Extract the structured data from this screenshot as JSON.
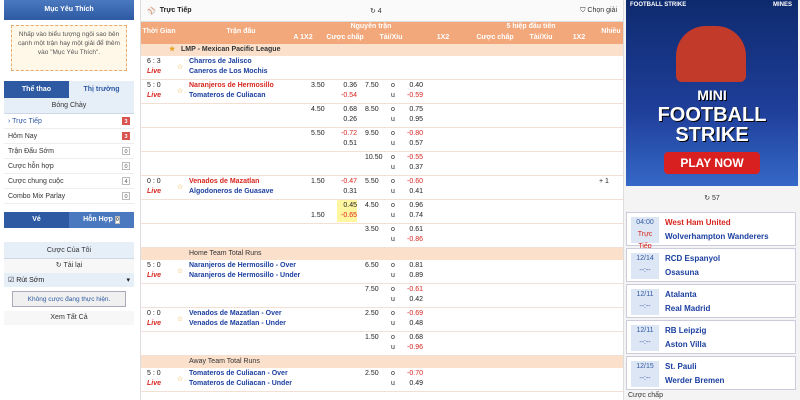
{
  "left": {
    "favorites_title": "Mục Yêu Thích",
    "favorites_hint": "Nhấp vào biểu tượng ngôi sao bên cạnh một trận hay một giải để thêm vào \"Mục Yêu Thích\".",
    "tab_sports": "Thể thao",
    "tab_market": "Thị trường",
    "sport_header": "Bóng Chày",
    "menu": [
      {
        "label": "Trực Tiếp",
        "count": "3"
      },
      {
        "label": "Hôm Nay",
        "count": "3"
      },
      {
        "label": "Trận Đấu Sớm",
        "count": "0"
      },
      {
        "label": "Cược hỗn hợp",
        "count": "0"
      },
      {
        "label": "Cược chung cuộc",
        "count": "4"
      },
      {
        "label": "Combo Mix Parlay",
        "count": "0"
      }
    ],
    "slip_single": "Vé",
    "slip_mix": "Hỗn Hợp",
    "slip_mix_count": "0",
    "mybets_title": "Cược Của Tôi",
    "reload": "Tải lại",
    "cashout": "Rút Sớm",
    "no_bets": "Không cược đang thực hiện.",
    "view_all": "Xem Tất Cả"
  },
  "main": {
    "live_label": "Trực Tiếp",
    "live_count": "4",
    "select_league": "Chọn giải",
    "head": {
      "time": "Thời Gian",
      "match": "Trận đấu",
      "full": "Nguyên trận",
      "half": "5 hiệp đầu tiên",
      "more": "Nhiều",
      "a1x2": "A 1X2",
      "hcap": "Cược chấp",
      "ou": "Tài/Xỉu",
      "x12": "1X2"
    },
    "league": "LMP - Mexican Pacific League",
    "rows": [
      {
        "time": "6 : 3",
        "live": "Live",
        "t1": "Charros de Jalisco",
        "t2": "Caneros de Los Mochis",
        "t1c": "blue",
        "t2c": "blue"
      },
      {
        "time": "5 : 0",
        "live": "Live",
        "t1": "Naranjeros de Hermosillo",
        "t2": "Tomateros de Culiacan",
        "t1c": "red",
        "t2c": "blue",
        "h": "3.50",
        "hv1": "0.36",
        "hv2": "-0.54",
        "o": "7.50",
        "ov1": "0.40",
        "ov2": "-0.59"
      },
      {
        "h": "4.50",
        "hv1": "0.68",
        "hv2": "0.26",
        "o": "8.50",
        "ov1": "0.75",
        "ov2": "0.95"
      },
      {
        "h": "5.50",
        "hv1": "-0.72",
        "hv2": "0.51",
        "o": "9.50",
        "ov1": "-0.80",
        "ov2": "0.57"
      },
      {
        "o": "10.50",
        "ov1": "-0.55",
        "ov2": "0.37"
      },
      {
        "time": "0 : 0",
        "live": "Live",
        "t1": "Venados de Mazatlan",
        "t2": "Algodoneros de Guasave",
        "t1c": "red",
        "t2c": "blue",
        "h": "1.50",
        "hv1": "-0.47",
        "hv2": "0.31",
        "o": "5.50",
        "ov1": "-0.60",
        "ov2": "0.41",
        "more": "+ 1"
      },
      {
        "h": "",
        "hv1": "0.45",
        "hv2": "-0.65",
        "h2": "1.50",
        "o": "4.50",
        "ov1": "0.96",
        "ov2": "0.74"
      },
      {
        "o": "3.50",
        "ov1": "0.61",
        "ov2": "-0.86"
      }
    ],
    "home_total": "Home Team Total Runs",
    "home_rows": [
      {
        "time": "5 : 0",
        "live": "Live",
        "t1": "Naranjeros de Hermosillo - Over",
        "t2": "Naranjeros de Hermosillo - Under",
        "o": "6.50",
        "ov1": "0.81",
        "ov2": "0.89"
      },
      {
        "o": "7.50",
        "ov1": "-0.61",
        "ov2": "0.42"
      },
      {
        "time": "0 : 0",
        "live": "Live",
        "t1": "Venados de Mazatlan - Over",
        "t2": "Venados de Mazatlan - Under",
        "o": "2.50",
        "ov1": "-0.69",
        "ov2": "0.48"
      },
      {
        "o": "1.50",
        "ov1": "0.68",
        "ov2": "-0.96"
      }
    ],
    "away_total": "Away Team Total Runs",
    "away_rows": [
      {
        "time": "5 : 0",
        "live": "Live",
        "t1": "Tomateros de Culiacan - Over",
        "t2": "Tomateros de Culiacan - Under",
        "o": "2.50",
        "ov1": "-0.70",
        "ov2": "0.49"
      }
    ]
  },
  "right": {
    "ad_top_left": "FOOTBALL STRIKE",
    "ad_top_right": "MINES",
    "ad_title_1": "MINI",
    "ad_title_2": "FOOTBALL",
    "ad_title_3": "STRIKE",
    "ad_button": "PLAY NOW",
    "count": "57",
    "matches": [
      {
        "d1": "04:00",
        "d2": "Trực Tiếp",
        "t1": "West Ham United",
        "t2": "Wolverhampton Wanderers"
      },
      {
        "d1": "12/14",
        "d2": "--:--",
        "t1": "RCD Espanyol",
        "t2": "Osasuna"
      },
      {
        "d1": "12/11",
        "d2": "--:--",
        "t1": "Atalanta",
        "t2": "Real Madrid"
      },
      {
        "d1": "12/11",
        "d2": "--:--",
        "t1": "RB Leipzig",
        "t2": "Aston Villa"
      },
      {
        "d1": "12/15",
        "d2": "--:--",
        "t1": "St. Pauli",
        "t2": "Werder Bremen"
      }
    ],
    "footer": "Cược chấp"
  },
  "colors": {
    "brand": "#2d5aa3",
    "header": "#f2a87a",
    "live": "#d7261e",
    "team": "#1b3fa0"
  }
}
